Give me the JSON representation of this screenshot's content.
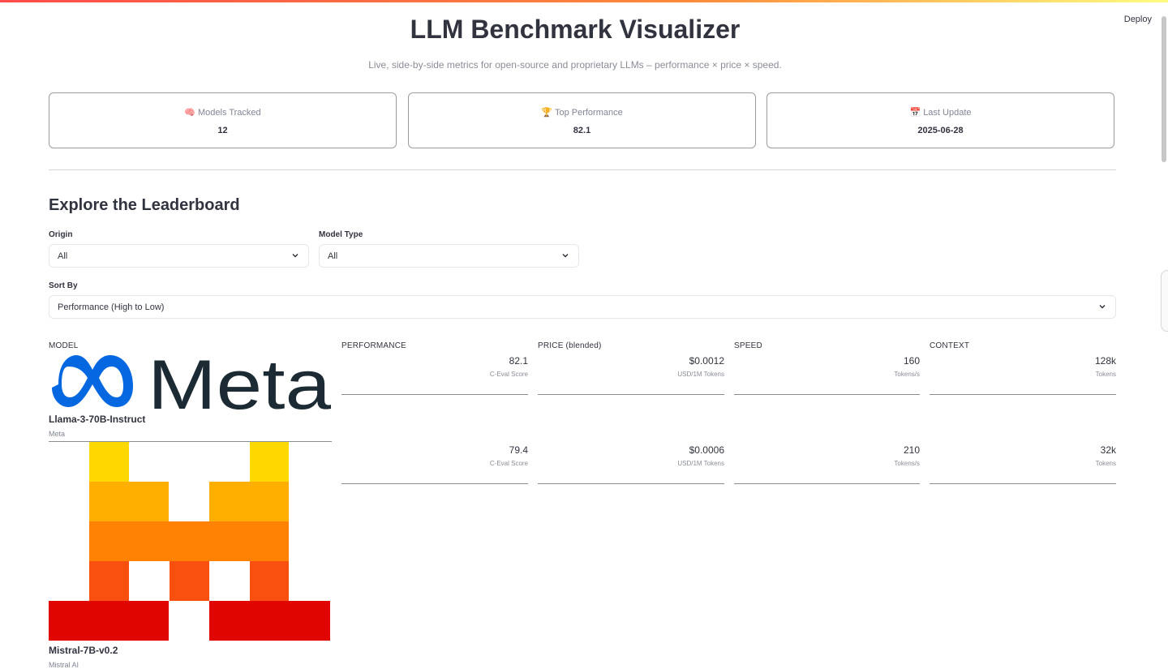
{
  "app": {
    "title": "LLM Benchmark Visualizer",
    "subtitle": "Live, side-by-side metrics for open-source and proprietary LLMs – performance × price × speed.",
    "deploy_label": "Deploy"
  },
  "kpis": [
    {
      "icon": "brain-icon",
      "emoji": "🧠",
      "label": "Models Tracked",
      "value": "12"
    },
    {
      "icon": "trophy-icon",
      "emoji": "🏆",
      "label": "Top Performance",
      "value": "82.1"
    },
    {
      "icon": "calendar-icon",
      "emoji": "📅",
      "label": "Last Update",
      "value": "2025-06-28"
    }
  ],
  "leaderboard": {
    "heading": "Explore the Leaderboard",
    "filters": {
      "origin": {
        "label": "Origin",
        "value": "All"
      },
      "model_type": {
        "label": "Model Type",
        "value": "All"
      },
      "sort_by": {
        "label": "Sort By",
        "value": "Performance (High to Low)"
      }
    },
    "columns": [
      "MODEL",
      "PERFORMANCE",
      "PRICE (blended)",
      "SPEED",
      "CONTEXT"
    ],
    "rows": [
      {
        "logo": "meta-logo",
        "logo_text": "Meta",
        "name": "Llama-3-70B-Instruct",
        "org": "Meta",
        "performance": {
          "value": "82.1",
          "unit": "C-Eval Score"
        },
        "price": {
          "value": "$0.0012",
          "unit": "USD/1M Tokens"
        },
        "speed": {
          "value": "160",
          "unit": "Tokens/s"
        },
        "context": {
          "value": "128k",
          "unit": "Tokens"
        }
      },
      {
        "logo": "mistral-logo",
        "name": "Mistral-7B-v0.2",
        "org": "Mistral AI",
        "performance": {
          "value": "79.4",
          "unit": "C-Eval Score"
        },
        "price": {
          "value": "$0.0006",
          "unit": "USD/1M Tokens"
        },
        "speed": {
          "value": "210",
          "unit": "Tokens/s"
        },
        "context": {
          "value": "32k",
          "unit": "Tokens"
        }
      }
    ]
  },
  "colors": {
    "accent_red": "#ff4b4b",
    "meta_blue": "#0668e1",
    "meta_text": "#1c2b33",
    "mistral_yellow": "#ffd800",
    "mistral_amber": "#ffaf00",
    "mistral_orange": "#ff8205",
    "mistral_redorange": "#fa500f",
    "mistral_red": "#e10500"
  }
}
